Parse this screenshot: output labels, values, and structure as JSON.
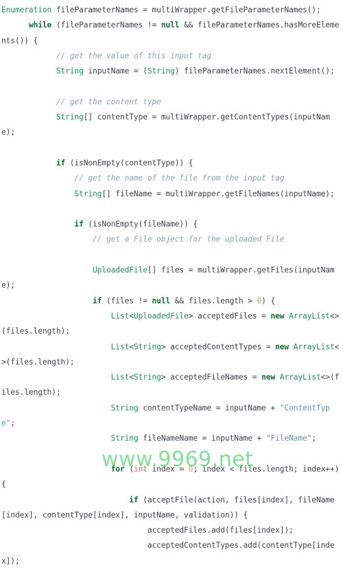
{
  "page": {
    "kind": "code-snippet",
    "language": "Java",
    "background_color": "#ffffff",
    "default_text_color": "#3a4248"
  },
  "theme": {
    "keyword_color": "#0c6b32",
    "type_color": "#23895a",
    "primitive_color": "#c86a5e",
    "number_color": "#c59a62",
    "string_color": "#6d8ea8",
    "comment_color": "#8aa3ab",
    "plain_color": "#3a4248"
  },
  "watermark": {
    "text": "www.9969.net",
    "color": "#3cc85a"
  },
  "code": {
    "full_text": "Enumeration fileParameterNames = multiWrapper.getFileParameterNames();\n      while (fileParameterNames != null && fileParameterNames.hasMoreElements()) {\n            // get the value of this input tag\n            String inputName = (String) fileParameterNames.nextElement();\n\n            // get the content type\n            String[] contentType = multiWrapper.getContentTypes(inputName);\n\n            if (isNonEmpty(contentType)) {\n                // get the name of the file from the input tag\n                String[] fileName = multiWrapper.getFileNames(inputName);\n\n                if (isNonEmpty(fileName)) {\n                    // get a File object for the uploaded File\n                    UploadedFile[] files = multiWrapper.getFiles(inputName);\n                    if (files != null && files.length > 0) {\n                        List<UploadedFile> acceptedFiles = new ArrayList<>(files.length);\n                        List<String> acceptedContentTypes = new ArrayList<>(files.length);\n                        List<String> acceptedFileNames = new ArrayList<>(files.length);\n                        String contentTypeName = inputName + \"ContentType\";\n                        String fileNameName = inputName + \"FileName\";\n\n                        for (int index = 0; index < files.length; index++) {\n                            if (acceptFile(action, files[index], fileName[index], contentType[index], inputName, validation)) {\n                                acceptedFiles.add(files[index]);\n                                acceptedContentTypes.add(contentType[index]);",
    "lines": [
      {
        "indent": "",
        "tokens": [
          {
            "t": "type",
            "v": "Enumeration"
          },
          {
            "t": "plain",
            "v": " fileParameterNames = multiWrapper.getFileParameterNames();"
          }
        ]
      },
      {
        "indent": "      ",
        "tokens": [
          {
            "t": "kw",
            "v": "while"
          },
          {
            "t": "plain",
            "v": " (fileParameterNames != "
          },
          {
            "t": "kw",
            "v": "null"
          },
          {
            "t": "plain",
            "v": " && fileParameterNames.hasMoreElements()) {"
          }
        ]
      },
      {
        "indent": "            ",
        "tokens": [
          {
            "t": "cmt",
            "v": "// get the value of this input tag"
          }
        ]
      },
      {
        "indent": "            ",
        "tokens": [
          {
            "t": "type",
            "v": "String"
          },
          {
            "t": "plain",
            "v": " inputName = ("
          },
          {
            "t": "type",
            "v": "String"
          },
          {
            "t": "plain",
            "v": ") fileParameterNames.nextElement();"
          }
        ]
      },
      {
        "indent": "",
        "tokens": []
      },
      {
        "indent": "            ",
        "tokens": [
          {
            "t": "cmt",
            "v": "// get the content type"
          }
        ]
      },
      {
        "indent": "            ",
        "tokens": [
          {
            "t": "type",
            "v": "String"
          },
          {
            "t": "plain",
            "v": "[] contentType = multiWrapper.getContentTypes(inputName);"
          }
        ]
      },
      {
        "indent": "",
        "tokens": []
      },
      {
        "indent": "            ",
        "tokens": [
          {
            "t": "kw",
            "v": "if"
          },
          {
            "t": "plain",
            "v": " (isNonEmpty(contentType)) {"
          }
        ]
      },
      {
        "indent": "                ",
        "tokens": [
          {
            "t": "cmt",
            "v": "// get the name of the file from the input tag"
          }
        ]
      },
      {
        "indent": "                ",
        "tokens": [
          {
            "t": "type",
            "v": "String"
          },
          {
            "t": "plain",
            "v": "[] fileName = multiWrapper.getFileNames(inputName);"
          }
        ]
      },
      {
        "indent": "",
        "tokens": []
      },
      {
        "indent": "                ",
        "tokens": [
          {
            "t": "kw",
            "v": "if"
          },
          {
            "t": "plain",
            "v": " (isNonEmpty(fileName)) {"
          }
        ]
      },
      {
        "indent": "                    ",
        "tokens": [
          {
            "t": "cmt",
            "v": "// get a File object for the uploaded File"
          }
        ]
      },
      {
        "indent": "",
        "tokens": []
      },
      {
        "indent": "                    ",
        "tokens": [
          {
            "t": "type",
            "v": "UploadedFile"
          },
          {
            "t": "plain",
            "v": "[] files = multiWrapper.getFiles(inputName);"
          }
        ]
      },
      {
        "indent": "                    ",
        "tokens": [
          {
            "t": "kw",
            "v": "if"
          },
          {
            "t": "plain",
            "v": " (files != "
          },
          {
            "t": "kw",
            "v": "null"
          },
          {
            "t": "plain",
            "v": " && files.length > "
          },
          {
            "t": "num",
            "v": "0"
          },
          {
            "t": "plain",
            "v": ") {"
          }
        ]
      },
      {
        "indent": "                        ",
        "tokens": [
          {
            "t": "type",
            "v": "List"
          },
          {
            "t": "plain",
            "v": "<"
          },
          {
            "t": "type",
            "v": "UploadedFile"
          },
          {
            "t": "plain",
            "v": "> acceptedFiles = "
          },
          {
            "t": "kw",
            "v": "new"
          },
          {
            "t": "plain",
            "v": " "
          },
          {
            "t": "type",
            "v": "ArrayList"
          },
          {
            "t": "plain",
            "v": "<>(files.length);"
          }
        ]
      },
      {
        "indent": "                        ",
        "tokens": [
          {
            "t": "type",
            "v": "List"
          },
          {
            "t": "plain",
            "v": "<"
          },
          {
            "t": "type",
            "v": "String"
          },
          {
            "t": "plain",
            "v": "> acceptedContentTypes = "
          },
          {
            "t": "kw",
            "v": "new"
          },
          {
            "t": "plain",
            "v": " "
          },
          {
            "t": "type",
            "v": "ArrayList"
          },
          {
            "t": "plain",
            "v": "<>(files.length);"
          }
        ]
      },
      {
        "indent": "                        ",
        "tokens": [
          {
            "t": "type",
            "v": "List"
          },
          {
            "t": "plain",
            "v": "<"
          },
          {
            "t": "type",
            "v": "String"
          },
          {
            "t": "plain",
            "v": "> acceptedFileNames = "
          },
          {
            "t": "kw",
            "v": "new"
          },
          {
            "t": "plain",
            "v": " "
          },
          {
            "t": "type",
            "v": "ArrayList"
          },
          {
            "t": "plain",
            "v": "<>(files.length);"
          }
        ]
      },
      {
        "indent": "                        ",
        "tokens": [
          {
            "t": "type",
            "v": "String"
          },
          {
            "t": "plain",
            "v": " contentTypeName = inputName + "
          },
          {
            "t": "str",
            "v": "\"ContentType\""
          },
          {
            "t": "plain",
            "v": ";"
          }
        ]
      },
      {
        "indent": "                        ",
        "tokens": [
          {
            "t": "type",
            "v": "String"
          },
          {
            "t": "plain",
            "v": " fileNameName = inputName + "
          },
          {
            "t": "str",
            "v": "\"FileName\""
          },
          {
            "t": "plain",
            "v": ";"
          }
        ]
      },
      {
        "indent": "",
        "tokens": []
      },
      {
        "indent": "                        ",
        "tokens": [
          {
            "t": "kw",
            "v": "for"
          },
          {
            "t": "plain",
            "v": " ("
          },
          {
            "t": "prim",
            "v": "int"
          },
          {
            "t": "plain",
            "v": " index = "
          },
          {
            "t": "num",
            "v": "0"
          },
          {
            "t": "plain",
            "v": "; index < files.length; index++) {"
          }
        ]
      },
      {
        "indent": "                            ",
        "tokens": [
          {
            "t": "kw",
            "v": "if"
          },
          {
            "t": "plain",
            "v": " (acceptFile(action, files[index], fileName[index], contentType[index], inputName, validation)) {"
          }
        ]
      },
      {
        "indent": "                                ",
        "tokens": [
          {
            "t": "plain",
            "v": "acceptedFiles.add(files[index]);"
          }
        ]
      },
      {
        "indent": "                                ",
        "tokens": [
          {
            "t": "plain",
            "v": "acceptedContentTypes.add(contentType[index]);"
          }
        ]
      }
    ]
  }
}
